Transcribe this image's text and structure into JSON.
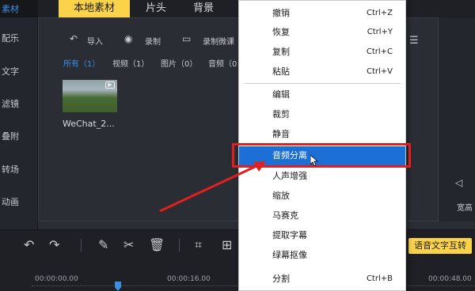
{
  "sidebar": {
    "brand": "素材",
    "items": [
      "配乐",
      "文字",
      "滤镜",
      "叠附",
      "转场",
      "动画"
    ]
  },
  "tabs": [
    {
      "label": "本地素材",
      "active": true
    },
    {
      "label": "片头",
      "active": false
    },
    {
      "label": "背景",
      "active": false
    }
  ],
  "toolbar": {
    "import": "导入",
    "record": "录制",
    "record_lesson": "录制微课"
  },
  "filters": [
    {
      "label": "所有（1）",
      "active": true
    },
    {
      "label": "视频（1）",
      "active": false
    },
    {
      "label": "图片（0）",
      "active": false
    },
    {
      "label": "音频（0",
      "active": false
    }
  ],
  "media": {
    "caption": "WeChat_2..."
  },
  "right_panel": {
    "label": "宽高"
  },
  "timeline": {
    "voice_text_button": "语音文字互转",
    "ruler": [
      "00:00:00.00",
      "00:00:16.00",
      "00:00:48.00"
    ]
  },
  "context_menu": {
    "items": [
      {
        "label": "撤销",
        "shortcut": "Ctrl+Z"
      },
      {
        "label": "恢复",
        "shortcut": "Ctrl+Y"
      },
      {
        "label": "复制",
        "shortcut": "Ctrl+C"
      },
      {
        "label": "粘贴",
        "shortcut": "Ctrl+V"
      },
      {
        "label": "编辑",
        "shortcut": ""
      },
      {
        "label": "裁剪",
        "shortcut": ""
      },
      {
        "label": "静音",
        "shortcut": ""
      },
      {
        "label": "音频分离",
        "shortcut": "",
        "highlighted": true
      },
      {
        "label": "人声增强",
        "shortcut": ""
      },
      {
        "label": "缩放",
        "shortcut": ""
      },
      {
        "label": "马赛克",
        "shortcut": ""
      },
      {
        "label": "提取字幕",
        "shortcut": ""
      },
      {
        "label": "绿幕抠像",
        "shortcut": ""
      },
      {
        "label": "分割",
        "shortcut": "Ctrl+B"
      }
    ]
  },
  "colors": {
    "accent": "#fad34a",
    "highlight": "#1c6fd6",
    "annotation": "#e02020"
  }
}
